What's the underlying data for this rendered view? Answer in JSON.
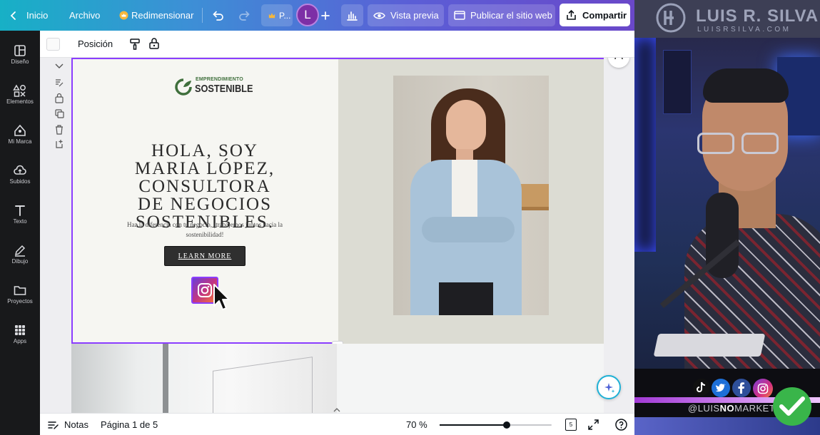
{
  "topbar": {
    "home": "Inicio",
    "file": "Archivo",
    "resize": "Redimensionar",
    "truncated": "P...",
    "avatar_letter": "L",
    "preview": "Vista previa",
    "publish": "Publicar el sitio web",
    "share": "Compartir"
  },
  "context_bar": {
    "position": "Posición"
  },
  "sidebar": {
    "items": [
      {
        "label": "Diseño",
        "icon": "layout-icon"
      },
      {
        "label": "Elementos",
        "icon": "shapes-icon"
      },
      {
        "label": "Mi Marca",
        "icon": "brand-icon"
      },
      {
        "label": "Subidos",
        "icon": "upload-cloud-icon"
      },
      {
        "label": "Texto",
        "icon": "text-icon"
      },
      {
        "label": "Dibujo",
        "icon": "pen-icon"
      },
      {
        "label": "Proyectos",
        "icon": "folder-icon"
      },
      {
        "label": "Apps",
        "icon": "apps-grid-icon"
      }
    ]
  },
  "design": {
    "logo_line1": "EMPRENDIMIENTO",
    "logo_line2": "SOSTENIBLE",
    "headline": "HOLA, SOY MARIA LÓPEZ, CONSULTORA DE NEGOCIOS SOSTENIBLES.",
    "subtext": "Haz la diferencia con tu negocio, ¡trabajemos juntos hacia la sostenibilidad!",
    "button": "LEARN MORE"
  },
  "bottombar": {
    "notes": "Notas",
    "page_info": "Página 1 de 5",
    "zoom": "70 %",
    "zoom_fraction": 0.6,
    "pages_count": "5"
  },
  "webcam": {
    "brand_name": "LUIS R. SILVA",
    "brand_url": "LUISRSILVA.COM",
    "handle_prefix": "@LUIS",
    "handle_bold": "NO",
    "handle_suffix": "MARKETING"
  },
  "colors": {
    "accent": "#8b3dff",
    "topbar_start": "#17b0c6",
    "topbar_end": "#6a48c9",
    "sidebar": "#18191b"
  }
}
